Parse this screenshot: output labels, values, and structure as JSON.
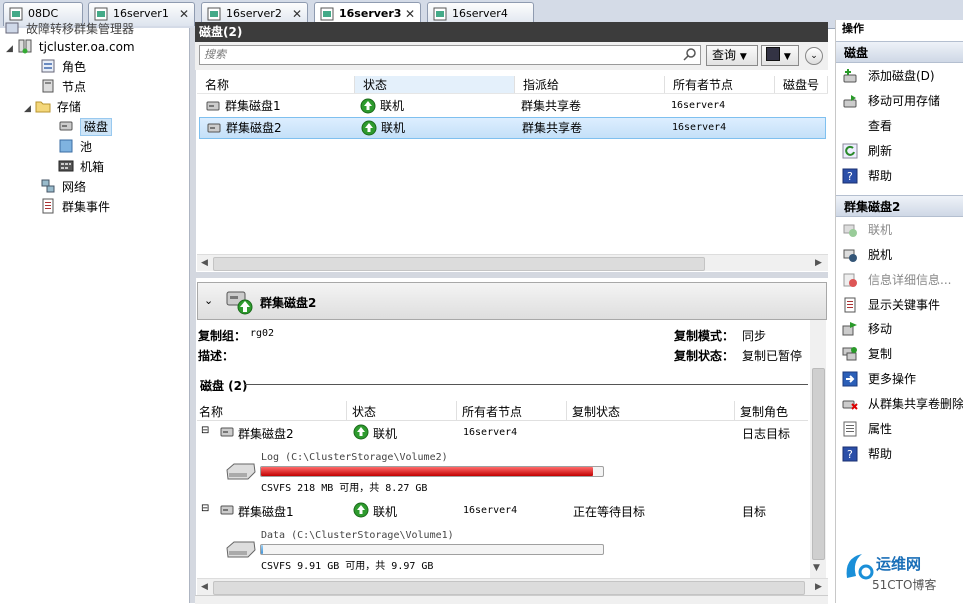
{
  "tabs": [
    {
      "label": "08DC",
      "active": false,
      "close": false
    },
    {
      "label": "16server1",
      "active": false,
      "close": true
    },
    {
      "label": "16server2",
      "active": false,
      "close": true
    },
    {
      "label": "16server3",
      "active": true,
      "close": true
    },
    {
      "label": "16server4",
      "active": false,
      "close": true
    }
  ],
  "tree": {
    "root_partial": "故障转移群集管理器",
    "cluster": "tjcluster.oa.com",
    "roles": "角色",
    "nodes": "节点",
    "storage": "存储",
    "disks": "磁盘",
    "pools": "池",
    "enclosures": "机箱",
    "networks": "网络",
    "events": "群集事件"
  },
  "center": {
    "title": "磁盘(2)",
    "search_placeholder": "搜索",
    "query_label": "查询",
    "columns": [
      "名称",
      "状态",
      "指派给",
      "所有者节点",
      "磁盘号"
    ],
    "rows": [
      {
        "name": "群集磁盘1",
        "status": "联机",
        "assigned": "群集共享卷",
        "owner": "16server4"
      },
      {
        "name": "群集磁盘2",
        "status": "联机",
        "assigned": "群集共享卷",
        "owner": "16server4"
      }
    ]
  },
  "detail": {
    "title": "群集磁盘2",
    "rep_group_label": "复制组：",
    "rep_group_value": "rg02",
    "desc_label": "描述：",
    "rep_mode_label": "复制模式：",
    "rep_mode_value": "同步",
    "rep_status_label": "复制状态：",
    "rep_status_value": "复制已暂停",
    "disks_section": "磁盘 (2)",
    "columns": [
      "名称",
      "状态",
      "所有者节点",
      "复制状态",
      "复制角色"
    ],
    "disks": [
      {
        "name": "群集磁盘2",
        "status": "联机",
        "owner": "16server4",
        "rep_state": "",
        "rep_role": "日志目标",
        "volume": "Log (C:\\ClusterStorage\\Volume2)",
        "fs_info": "CSVFS 218 MB 可用，共 8.27 GB",
        "used_fraction": 0.97
      },
      {
        "name": "群集磁盘1",
        "status": "联机",
        "owner": "16server4",
        "rep_state": "正在等待目标",
        "rep_role": "目标",
        "volume": "Data (C:\\ClusterStorage\\Volume1)",
        "fs_info": "CSVFS 9.91 GB 可用，共 9.97 GB",
        "used_fraction": 0.006
      }
    ]
  },
  "actions": {
    "header": "操作",
    "sec1": "磁盘",
    "sec1_items": [
      "添加磁盘(D)",
      "移动可用存储",
      "查看",
      "刷新",
      "帮助"
    ],
    "sec2": "群集磁盘2",
    "sec2_items": [
      "联机",
      "脱机",
      "信息详细信息...",
      "显示关键事件",
      "移动",
      "复制",
      "更多操作",
      "从群集共享卷删除",
      "属性",
      "帮助"
    ]
  },
  "watermark": {
    "line1": "运维网",
    "line2": "51CTO博客"
  },
  "colors": {
    "accent": "#cde4f7",
    "selected_row": "#c4e0f8",
    "usage_bar": "#d40000",
    "online_icon": "#2e9b2e"
  }
}
